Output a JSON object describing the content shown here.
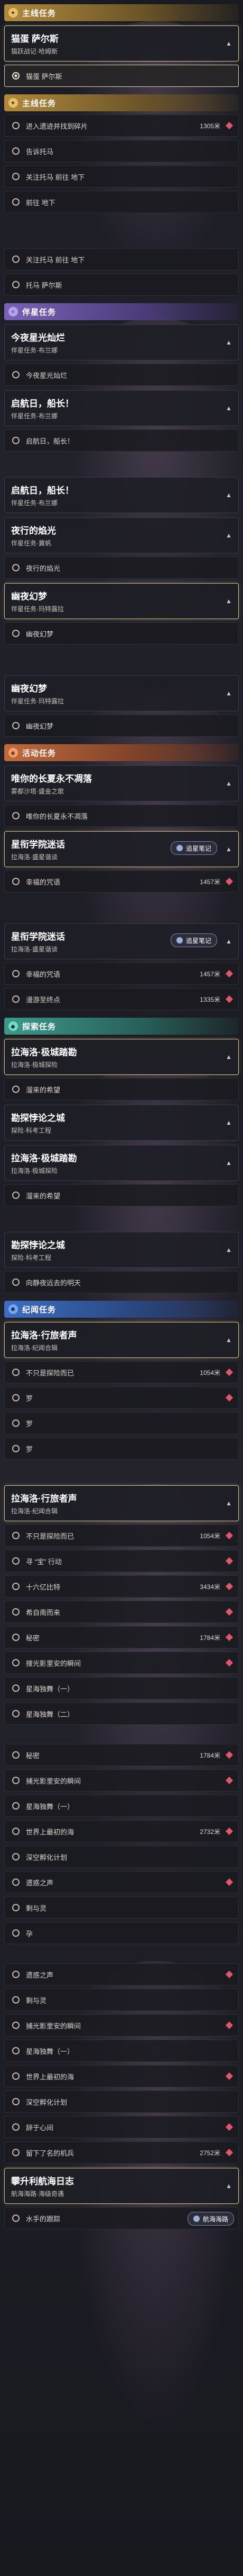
{
  "col1": {
    "section_title": "主线任务",
    "card1": {
      "title": "猫蛋 萨尔斯",
      "subtitle": "猫跃战记·哈姆斯",
      "objectives": [
        {
          "text": "猫蛋 萨尔斯"
        }
      ]
    }
  },
  "col2": {
    "section_title": "主线任务",
    "objectives": [
      {
        "text": "进入遗迹并找到碎片",
        "dist": "1305米"
      },
      {
        "text": "告诉托马"
      },
      {
        "text": "关注托马 前往 地下"
      },
      {
        "text": "前往 地下"
      }
    ]
  },
  "col3": {
    "objectives": [
      {
        "text": "关注托马 前往 地下"
      },
      {
        "text": "托马 萨尔斯"
      }
    ]
  },
  "col4": {
    "section_title": "伴星任务",
    "cards": [
      {
        "title": "今夜星光灿烂",
        "subtitle": "伴星任务·布兰娜"
      },
      {
        "title": "启航日，船长！",
        "subtitle": "伴星任务·布兰娜"
      },
      {
        "title": "启航日，船长！",
        "subtitle": "伴星任务·布兰娜"
      },
      {
        "title": "夜行的焰光",
        "subtitle": "伴星任务·冀帆"
      },
      {
        "title": "幽夜幻梦",
        "subtitle": "伴星任务·玛特露拉"
      },
      {
        "title": "幽夜幻梦",
        "subtitle": "伴星任务·玛特露拉"
      }
    ],
    "obj_today": "今夜星光灿烂",
    "obj_launch": "启航日，船长！",
    "obj_flame": "夜行的焰光",
    "obj_dream": "幽夜幻梦",
    "obj_dream2": "幽夜幻梦"
  },
  "col5": {
    "section_title": "活动任务",
    "cards": [
      {
        "title": "唯你的长夏永不凋落",
        "subtitle": "雾都沙塔·盛金之歌"
      },
      {
        "title": "星衔学院迷话",
        "subtitle": "拉海洛·盛星谐谈"
      },
      {
        "title": "星衔学院迷话",
        "subtitle": "拉海洛·盛星谐谈"
      }
    ],
    "obj_summer": "唯你的长夏永不凋落",
    "obj_star1": "幸福的咒语",
    "obj_star2": "幸福的咒语",
    "obj_star3": "漫游至终点",
    "tooltip1": "追星笔记",
    "dist1": "1457米",
    "tooltip2": "追星笔记",
    "dist2": "1457米",
    "dist3": "1335米"
  },
  "col6": {
    "section_title": "探索任务",
    "cards": [
      {
        "title": "拉海洛·极城踏勘",
        "subtitle": "拉海洛·极城探险"
      },
      {
        "title": "勘探悖论之城",
        "subtitle": "探险·科考工程"
      },
      {
        "title": "拉海洛·极城踏勘",
        "subtitle": "拉海洛·极城探险"
      },
      {
        "title": "勘探悖论之城",
        "subtitle": "探险·科考工程"
      }
    ],
    "obj_a": "溜来的希望",
    "obj_b": "溜来的希望",
    "obj_c": "向静夜远去的明天"
  },
  "col7": {
    "section_title": "纪闻任务",
    "cards": [
      {
        "title": "拉海洛·行旅者声",
        "subtitle": "拉海洛·纪闻合辑"
      },
      {
        "title": "拉海洛·行旅者声",
        "subtitle": "拉海洛·纪闻合辑"
      }
    ],
    "list1": [
      {
        "text": "不只是探险而已",
        "dist": "1054米"
      },
      {
        "text": "罗"
      },
      {
        "text": "罗"
      },
      {
        "text": "罗"
      }
    ],
    "list2": [
      {
        "text": "不只是探险而已",
        "dist": "1054米"
      },
      {
        "text": "寻 “宝” 行动"
      },
      {
        "text": "十六亿比特",
        "dist": "3434米"
      },
      {
        "text": "希自南而来"
      },
      {
        "text": "秘密",
        "dist": "1784米"
      },
      {
        "text": "搜光影里安的瞬间"
      },
      {
        "text": "星海独舞（一）"
      },
      {
        "text": "星海独舞（二）"
      }
    ]
  },
  "col8": {
    "list": [
      {
        "text": "秘密",
        "dist": "1784米"
      },
      {
        "text": "捕光影里安的瞬间"
      },
      {
        "text": "星海独舞（一）"
      },
      {
        "text": "世界上最初的海",
        "dist": "2732米"
      },
      {
        "text": "深空孵化计划"
      },
      {
        "text": "遗惑之声"
      },
      {
        "text": "剩与灵"
      },
      {
        "text": "孕"
      }
    ]
  },
  "col9": {
    "list": [
      {
        "text": "遗惑之声"
      },
      {
        "text": "剩与灵"
      },
      {
        "text": "捕光影里安的瞬间"
      },
      {
        "text": "星海独舞（一）"
      },
      {
        "text": "世界上最初的海"
      },
      {
        "text": "深空孵化计划"
      },
      {
        "text": "辞于心间"
      },
      {
        "text": "留下了名的机兵",
        "dist": "2752米"
      }
    ],
    "card": {
      "title": "攀升利航海日志",
      "subtitle": "航海海路·海级奇遇"
    },
    "last_obj": "水手的跟踪",
    "tooltip_last": "航海海路"
  },
  "colors": {
    "gold": "#b08a3c",
    "purple": "#7a62b8",
    "orange": "#c26a3c",
    "teal": "#3c9a8a",
    "blue": "#3c6ec2",
    "active_border": "#d9c48a",
    "marker": "#e0566a"
  },
  "icons": [
    "gold-quest-icon",
    "purple-quest-icon",
    "orange-quest-icon",
    "teal-quest-icon",
    "blue-quest-icon",
    "chevron-icon",
    "radio-icon",
    "marker-icon"
  ]
}
